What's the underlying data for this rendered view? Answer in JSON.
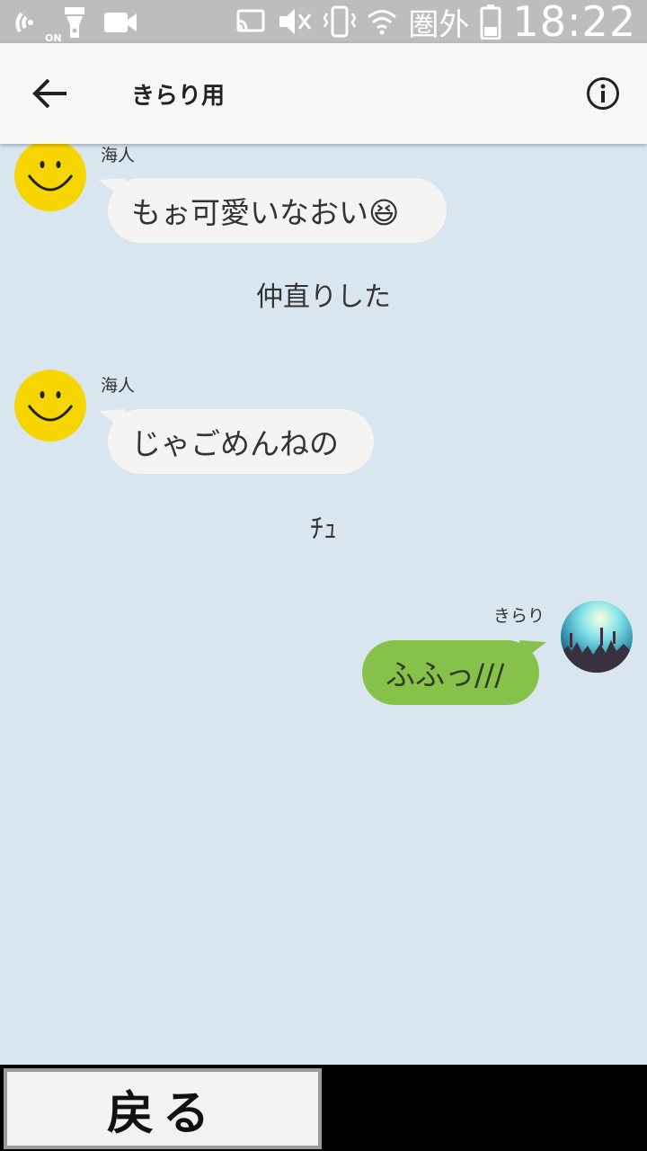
{
  "status_bar": {
    "on_label": "ON",
    "carrier": "圏外",
    "time": "18:22",
    "icons": [
      "nfc-icon",
      "flashlight-icon",
      "video-icon",
      "cast-icon",
      "mute-icon",
      "vibrate-icon",
      "wifi-icon",
      "battery-icon"
    ]
  },
  "header": {
    "title": "きらり用",
    "back_icon": "arrow-left-icon",
    "info_icon": "info-icon"
  },
  "messages": [
    {
      "sender": "海人",
      "text": "もぉ可愛いなおい😆",
      "side": "left",
      "avatar": "smiley-face"
    },
    {
      "system": "仲直りした"
    },
    {
      "sender": "海人",
      "text": "じゃごめんねの",
      "side": "left",
      "avatar": "smiley-face"
    },
    {
      "system": "ﾁｭ"
    },
    {
      "sender": "きらり",
      "text": "ふふっ///",
      "side": "right",
      "avatar": "concert-photo"
    }
  ],
  "bottom": {
    "back_label": "戻る"
  },
  "colors": {
    "background": "#d9e5ef",
    "bubble_left": "#f4f5f3",
    "bubble_right": "#86c24a",
    "status_bar": "#bdbdbd"
  }
}
